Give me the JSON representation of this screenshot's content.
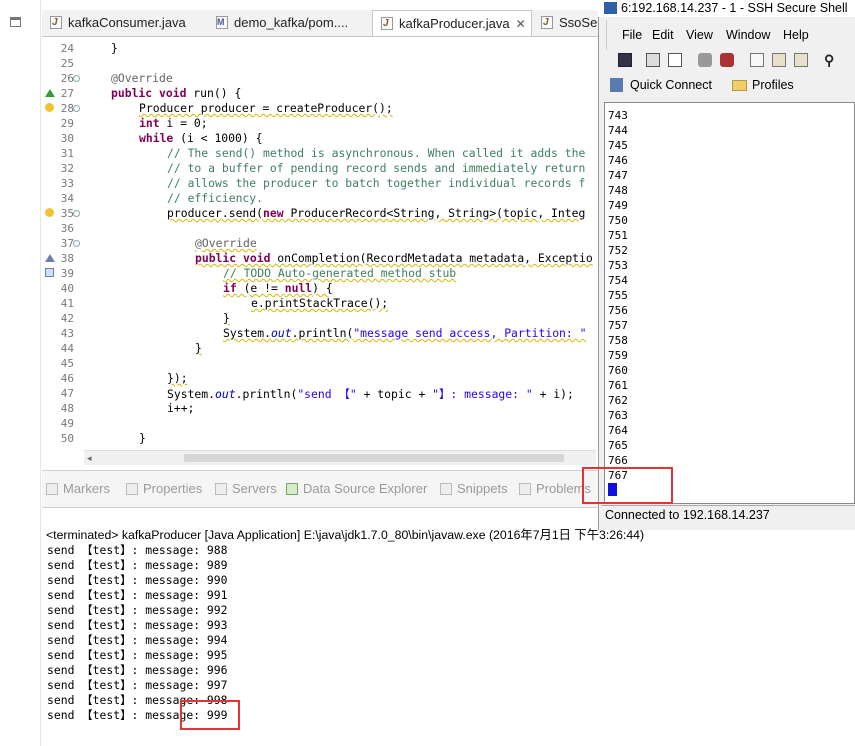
{
  "editor_tabs": [
    {
      "label": "kafkaConsumer.java",
      "icon": "java-file-icon"
    },
    {
      "label": "demo_kafka/pom....",
      "icon": "maven-file-icon"
    },
    {
      "label": "kafkaProducer.java",
      "icon": "java-file-icon",
      "close": "✕"
    },
    {
      "label": "SsoSer",
      "icon": "java-file-icon"
    }
  ],
  "code": {
    "line_numbers": [
      "24",
      "25",
      "26",
      "27",
      "28",
      "29",
      "30",
      "31",
      "32",
      "33",
      "34",
      "35",
      "36",
      "37",
      "38",
      "39",
      "40",
      "41",
      "42",
      "43",
      "44",
      "45",
      "46",
      "47",
      "48",
      "49",
      "50"
    ],
    "lines": {
      "l24": "}",
      "l26": "@Override",
      "l27a": "public void",
      "l27b": " run() {",
      "l28": "Producer producer = createProducer();",
      "l29a": "int",
      "l29b": " i = 0;",
      "l30a": "while",
      "l30b": " (i < 1000) {",
      "l31": "// The send() method is asynchronous. When called it adds the",
      "l32": "// to a buffer of pending record sends and immediately return",
      "l33": "// allows the producer to batch together individual records f",
      "l34": "// efficiency.",
      "l35a": "producer.send(",
      "l35b": "new",
      "l35c": " ProducerRecord<String, String>(topic, Integ",
      "l37": "@Override",
      "l38a": "public void",
      "l38b": " onCompletion(RecordMetadata metadata, Exceptio",
      "l39": "// TODO Auto-generated method stub",
      "l40a": "if",
      "l40b": " (e != ",
      "l40c": "null",
      "l40d": ") {",
      "l41": "e.printStackTrace();",
      "l42": "}",
      "l43a": "System.",
      "l43b": "out",
      "l43c": ".println(",
      "l43d": "\"message send access, Partition: \"",
      "l44": "}",
      "l46": "});",
      "l47a": "System.",
      "l47b": "out",
      "l47c": ".println(",
      "l47d": "\"send 【\"",
      "l47e": " + topic + ",
      "l47f": "\"】: message: \"",
      "l47g": " + i);",
      "l48": "i++;",
      "l50": "}"
    }
  },
  "view_tabs": [
    "Markers",
    "Properties",
    "Servers",
    "Data Source Explorer",
    "Snippets",
    "Problems"
  ],
  "console": {
    "terminated": "<terminated> kafkaProducer [Java Application] E:\\java\\jdk1.7.0_80\\bin\\javaw.exe (2016年7月1日 下午3:26:44)",
    "lines": [
      "send 【test】: message: 988",
      "send 【test】: message: 989",
      "send 【test】: message: 990",
      "send 【test】: message: 991",
      "send 【test】: message: 992",
      "send 【test】: message: 993",
      "send 【test】: message: 994",
      "send 【test】: message: 995",
      "send 【test】: message: 996",
      "send 【test】: message: 997",
      "send 【test】: message: 998",
      "send 【test】: message: 999"
    ]
  },
  "ssh": {
    "title": "6:192.168.14.237 - 1 - SSH Secure Shell",
    "menu": [
      "File",
      "Edit",
      "View",
      "Window",
      "Help"
    ],
    "quick_connect": "Quick Connect",
    "profiles": "Profiles",
    "terminal_lines": [
      "743",
      "744",
      "745",
      "746",
      "747",
      "748",
      "749",
      "750",
      "751",
      "752",
      "753",
      "754",
      "755",
      "756",
      "757",
      "758",
      "759",
      "760",
      "761",
      "762",
      "763",
      "764",
      "765",
      "766",
      "767"
    ],
    "status": "Connected to 192.168.14.237"
  },
  "colors": {
    "highlight_box": "#e23434",
    "keyword": "#7f0055",
    "comment": "#3f7f5f",
    "string": "#2a00ff"
  }
}
